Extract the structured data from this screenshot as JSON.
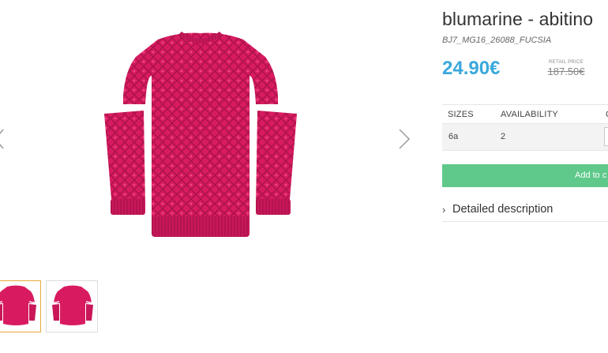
{
  "product": {
    "title": "blumarine - abitino",
    "sku": "BJ7_MG16_26088_FUCSIA",
    "price": "24.90€",
    "retail_label": "RETAIL PRICE",
    "retail_price": "187.50€"
  },
  "table": {
    "headers": [
      "SIZES",
      "AVAILABILITY",
      "Q"
    ],
    "rows": [
      {
        "size": "6a",
        "availability": "2"
      }
    ]
  },
  "cart_button": "Add to c",
  "description_label": "Detailed description",
  "colors": {
    "accent_price": "#3aa8dc",
    "cart_green": "#5ec98a",
    "sweater": "#d81b60",
    "thumb_active_border": "#e8a93a"
  },
  "icons": {
    "prev": "chevron-left-icon",
    "next": "chevron-right-icon",
    "description": "chevron-right-icon"
  }
}
